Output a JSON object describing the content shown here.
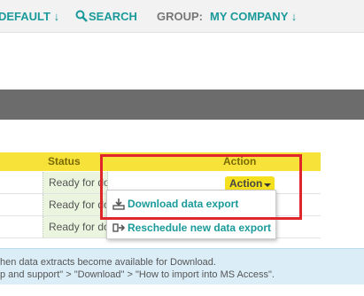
{
  "topbar": {
    "default_label": "DEFAULT",
    "default_arrow": "↓",
    "search_label": "SEARCH",
    "group_label": "GROUP:",
    "company_label": "MY COMPANY",
    "company_arrow": "↓"
  },
  "table": {
    "headers": {
      "status": "Status",
      "action": "Action"
    },
    "rows": [
      {
        "status": "Ready for download"
      },
      {
        "status": "Ready for do"
      },
      {
        "status": "Ready for do"
      }
    ]
  },
  "action_button": {
    "label": "Action"
  },
  "menu": {
    "items": [
      {
        "label": "Download data export",
        "icon": "download-icon"
      },
      {
        "label": "Reschedule new data export",
        "icon": "reschedule-icon"
      }
    ]
  },
  "info": {
    "line1": "hen data extracts become available for Download.",
    "line2": "p and support\" > \"Download\" > \"How to import into MS Access\"."
  },
  "colors": {
    "accent": "#1a9a9a",
    "header_yellow": "#f7e23a",
    "highlight_red": "#e0262a",
    "status_green": "#eaf4df",
    "info_blue": "#dbeef7"
  }
}
